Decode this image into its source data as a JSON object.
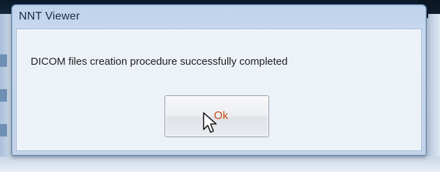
{
  "window": {
    "title": "NNT Viewer"
  },
  "dialog": {
    "message": "DICOM files creation procedure successfully completed",
    "ok_label": "Ok"
  },
  "colors": {
    "title_bar": "#bfd3ec",
    "client_area": "#edf2f8",
    "ok_text": "#c8501a"
  },
  "icons": {
    "cursor": "mouse-pointer-arrow"
  }
}
